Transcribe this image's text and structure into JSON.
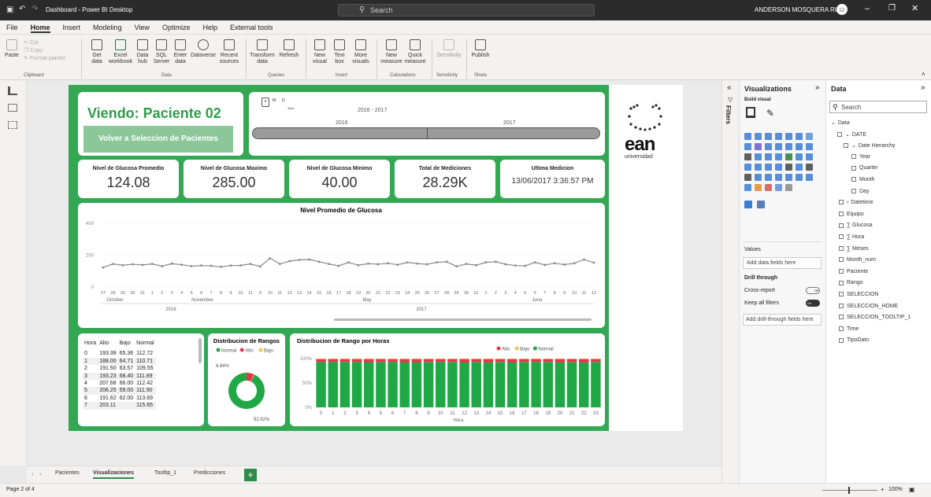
{
  "window": {
    "title": "Dashboard - Power BI Desktop",
    "search": "Search",
    "user": "ANDERSON MOSQUERA RUIZ"
  },
  "menu": [
    "File",
    "Home",
    "Insert",
    "Modeling",
    "View",
    "Optimize",
    "Help",
    "External tools"
  ],
  "ribbon": {
    "clipboard": {
      "paste": "Paste",
      "cut": "Cut",
      "copy": "Copy",
      "format_painter": "Format painter",
      "group": "Clipboard"
    },
    "data": {
      "get": "Get",
      "get2": "data",
      "excel": "Excel",
      "excel2": "workbook",
      "hub": "Data",
      "hub2": "hub",
      "sql": "SQL",
      "sql2": "Server",
      "enter": "Enter",
      "enter2": "data",
      "dataverse": "Dataverse",
      "recent": "Recent",
      "recent2": "sources",
      "group": "Data"
    },
    "queries": {
      "transform": "Transform",
      "transform2": "data",
      "refresh": "Refresh",
      "group": "Queries"
    },
    "insert": {
      "new": "New",
      "new2": "visual",
      "text": "Text",
      "text2": "box",
      "more": "More",
      "more2": "visuals",
      "group": "Insert"
    },
    "calculations": {
      "new": "New",
      "new2": "measure",
      "quick": "Quick",
      "quick2": "measure",
      "group": "Calculations"
    },
    "sensitivity": {
      "label": "Sensitivity",
      "group": "Sensitivity"
    },
    "share": {
      "publish": "Publish",
      "group": "Share"
    }
  },
  "report": {
    "title": "Viendo: Paciente 02",
    "back_button": "Volver a Seleccion de Pacientes",
    "slicer": {
      "y": "Y",
      "m": "M",
      "d": "D",
      "level": "Year",
      "range": "2016 - 2017",
      "left_year": "2016",
      "right_year": "2017"
    },
    "logo_text": "ean",
    "logo_sub": "universidad",
    "kpis": [
      {
        "label": "Nivel de Glucosa Promedio",
        "value": "124.08"
      },
      {
        "label": "Nivel de Glucosa Maximo",
        "value": "285.00"
      },
      {
        "label": "Nivel de Glucosa Minimo",
        "value": "40.00"
      },
      {
        "label": "Total de Mediciones",
        "value": "28.29K"
      },
      {
        "label": "Ultima Medicion",
        "value": "13/06/2017 3:36:57 PM"
      }
    ],
    "table": {
      "headers": [
        "Hora",
        "Alto",
        "Bajo",
        "Normal"
      ],
      "rows": [
        [
          "0",
          "193.38",
          "65.36",
          "112.72"
        ],
        [
          "1",
          "188.00",
          "64.71",
          "110.71"
        ],
        [
          "2",
          "191.50",
          "63.57",
          "109.55"
        ],
        [
          "3",
          "193.23",
          "68.40",
          "111.89"
        ],
        [
          "4",
          "207.68",
          "66.00",
          "112.42"
        ],
        [
          "5",
          "206.25",
          "59.00",
          "111.90"
        ],
        [
          "6",
          "191.62",
          "62.00",
          "113.69"
        ],
        [
          "7",
          "203.11",
          "",
          "115.65"
        ]
      ]
    }
  },
  "chart_data": [
    {
      "type": "line",
      "title": "Nivel Promedio de Glucosa",
      "ylim": [
        0,
        400
      ],
      "yticks": [
        "400",
        "200",
        "0"
      ],
      "x": [
        "27",
        "28",
        "29",
        "30",
        "31",
        "1",
        "2",
        "3",
        "4",
        "5",
        "6",
        "7",
        "8",
        "9",
        "10",
        "11",
        "9",
        "10",
        "11",
        "12",
        "13",
        "14",
        "15",
        "16",
        "17",
        "18",
        "19",
        "20",
        "21",
        "22",
        "23",
        "24",
        "25",
        "26",
        "27",
        "28",
        "29",
        "30",
        "31",
        "1",
        "2",
        "3",
        "4",
        "5",
        "6",
        "7",
        "8",
        "9",
        "10",
        "11",
        "12"
      ],
      "months": [
        "October",
        "November",
        "May",
        "June"
      ],
      "years": [
        "2016",
        "2017"
      ],
      "values": [
        118,
        140,
        132,
        138,
        134,
        140,
        126,
        142,
        135,
        126,
        130,
        128,
        122,
        130,
        131,
        140,
        124,
        176,
        140,
        158,
        166,
        168,
        154,
        140,
        128,
        150,
        132,
        142,
        138,
        144,
        135,
        150,
        142,
        138,
        150,
        154,
        125,
        140,
        132,
        150,
        154,
        138,
        130,
        128,
        150,
        134,
        144,
        136,
        144,
        168,
        148
      ]
    },
    {
      "type": "pie",
      "title": "Distribucion de Rangos",
      "legend": [
        "Normal",
        "Alto",
        "Bajo"
      ],
      "colors": [
        "#21a846",
        "#e03a4a",
        "#f2c744"
      ],
      "slices": [
        92.62,
        6.84,
        0.54
      ],
      "labels": [
        "6.84%",
        "92.62%"
      ]
    },
    {
      "type": "bar",
      "title": "Distribucion de Rango por Horas",
      "legend": [
        "Alto",
        "Bajo",
        "Normal"
      ],
      "colors": [
        "#e03a4a",
        "#f2c744",
        "#21a846"
      ],
      "categories": [
        "0",
        "1",
        "2",
        "3",
        "4",
        "5",
        "6",
        "7",
        "8",
        "9",
        "10",
        "11",
        "12",
        "13",
        "14",
        "15",
        "16",
        "17",
        "18",
        "19",
        "20",
        "21",
        "22",
        "23"
      ],
      "xlabel": "Hora",
      "yticks": [
        "100%",
        "50%",
        "0%"
      ],
      "series": [
        {
          "name": "Normal",
          "values": [
            93,
            93,
            93,
            93,
            92,
            93,
            93,
            92,
            92,
            93,
            93,
            93,
            92,
            93,
            92,
            93,
            92,
            93,
            93,
            93,
            92,
            93,
            92,
            93
          ]
        },
        {
          "name": "Alto",
          "values": [
            6,
            6,
            6,
            6,
            7,
            6,
            6,
            7,
            7,
            6,
            6,
            6,
            7,
            6,
            7,
            6,
            7,
            6,
            6,
            6,
            7,
            6,
            7,
            6
          ]
        },
        {
          "name": "Bajo",
          "values": [
            1,
            1,
            1,
            1,
            1,
            1,
            1,
            1,
            1,
            1,
            1,
            1,
            1,
            1,
            1,
            1,
            1,
            1,
            1,
            1,
            1,
            1,
            1,
            1
          ]
        }
      ]
    }
  ],
  "visualizations": {
    "title": "Visualizations",
    "build": "Build visual",
    "values": "Values",
    "values_placeholder": "Add data fields here",
    "drill": "Drill through",
    "cross": "Cross-report",
    "cross_state": "Off",
    "keep": "Keep all filters",
    "keep_state": "On",
    "drill_placeholder": "Add drill-through fields here"
  },
  "filters_label": "Filters",
  "data_pane": {
    "title": "Data",
    "search": "Search",
    "fields": [
      "Data",
      "DATE",
      "Date Hierarchy",
      "Year",
      "Quarter",
      "Month",
      "Day",
      "Datetime",
      "Equipo",
      "Glucosa",
      "Hora",
      "Meses",
      "Month_num",
      "Paciente",
      "Rango",
      "SELECCION",
      "SELECCION_HOME",
      "SELECCION_TOOLTIP_1",
      "Time",
      "TipoDato"
    ]
  },
  "tabs": [
    "Pacientes",
    "Visualizaciones",
    "Tooltip_1",
    "Predicciones"
  ],
  "status": {
    "page": "Page 2 of 4",
    "zoom": "100%"
  }
}
